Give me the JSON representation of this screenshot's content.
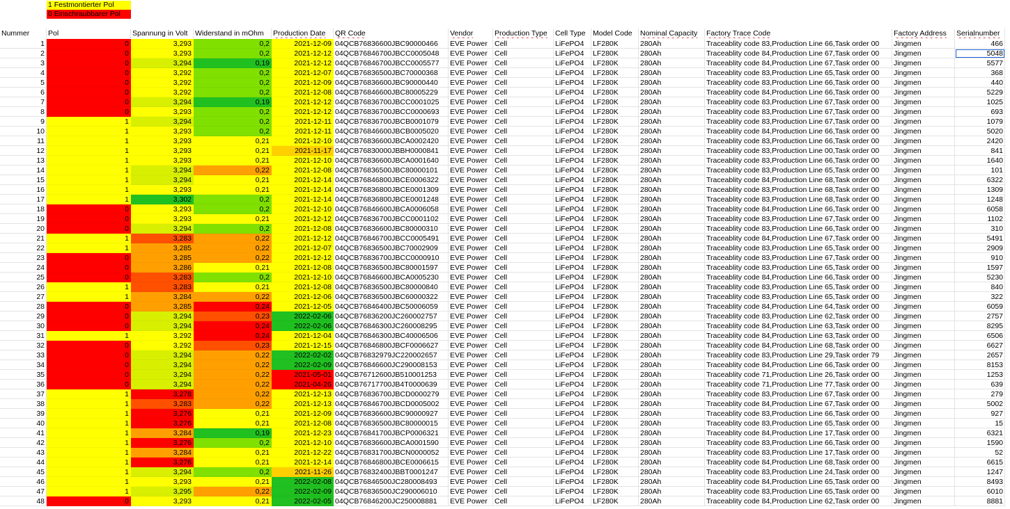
{
  "legend": [
    {
      "text": "1 Festmontierter Pol",
      "color": "#ffff00"
    },
    {
      "text": "0 Einschraubbarer Pol",
      "color": "#ff0000"
    }
  ],
  "headers": [
    "Nummer",
    "Pol",
    "Spannung in Volt",
    "Widerstand in mOhm",
    "Production Date",
    "QR Code",
    "Vendor",
    "Production Type",
    "Cell Type",
    "Model Code",
    "Nominal Capacity",
    "Factory Trace Code",
    "Factory Address",
    "Serialnumber"
  ],
  "constants": {
    "vendor": "EVE Power",
    "type": "Cell",
    "cell": "LiFePO4",
    "model": "LF280K",
    "capacity": "280Ah",
    "address": "Jingmen"
  },
  "colors": {
    "red": "#ff0000",
    "orange_red": "#ff5000",
    "orange": "#ffa000",
    "yellow_orange": "#ffd000",
    "yellow": "#ffff00",
    "yellow_green": "#d8f000",
    "light_green": "#80e000",
    "green": "#20c020",
    "selection": "#1f5fd6"
  },
  "rows": [
    [
      "1",
      "0",
      "3,293",
      "0,2",
      "2021-12-09",
      "04QCB76836600JBC90000466",
      "Traceablity code 83,Production Line 66,Task order 00",
      "466"
    ],
    [
      "2",
      "0",
      "3,293",
      "0,2",
      "2021-12-12",
      "04QCB76846700JBCC0005048",
      "Traceablity code 84,Production Line 67,Task order 00",
      "5048"
    ],
    [
      "3",
      "0",
      "3,294",
      "0,19",
      "2021-12-12",
      "04QCB76846700JBCC0005577",
      "Traceablity code 84,Production Line 67,Task order 00",
      "5577"
    ],
    [
      "4",
      "0",
      "3,292",
      "0,2",
      "2021-12-07",
      "04QCB76836500JBC70000368",
      "Traceablity code 83,Production Line 65,Task order 00",
      "368"
    ],
    [
      "5",
      "0",
      "3,292",
      "0,2",
      "2021-12-09",
      "04QCB76836600JBC90000440",
      "Traceablity code 83,Production Line 66,Task order 00",
      "440"
    ],
    [
      "6",
      "0",
      "3,292",
      "0,2",
      "2021-12-08",
      "04QCB76846600JBC80005229",
      "Traceablity code 84,Production Line 66,Task order 00",
      "5229"
    ],
    [
      "7",
      "0",
      "3,294",
      "0,19",
      "2021-12-12",
      "04QCB76836700JBCC0001025",
      "Traceablity code 83,Production Line 67,Task order 00",
      "1025"
    ],
    [
      "8",
      "0",
      "3,293",
      "0,2",
      "2021-12-12",
      "04QCB76836700JBCC0000693",
      "Traceablity code 83,Production Line 67,Task order 00",
      "693"
    ],
    [
      "9",
      "1",
      "3,294",
      "0,2",
      "2021-12-11",
      "04QCB76836700JBCB0001079",
      "Traceablity code 83,Production Line 67,Task order 00",
      "1079"
    ],
    [
      "10",
      "1",
      "3,293",
      "0,2",
      "2021-12-11",
      "04QCB76846600JBCB0005020",
      "Traceablity code 84,Production Line 66,Task order 00",
      "5020"
    ],
    [
      "11",
      "1",
      "3,293",
      "0,21",
      "2021-12-10",
      "04QCB76836600JBCA0002420",
      "Traceablity code 83,Production Line 66,Task order 00",
      "2420"
    ],
    [
      "12",
      "1",
      "3,293",
      "0,21",
      "2021-11-17",
      "04QCB76830000JBBH0000841",
      "Traceablity code 83,Production Line 00,Task order 00",
      "841"
    ],
    [
      "13",
      "1",
      "3,293",
      "0,21",
      "2021-12-10",
      "04QCB76836600JBCA0001640",
      "Traceablity code 83,Production Line 66,Task order 00",
      "1640"
    ],
    [
      "14",
      "1",
      "3,294",
      "0,22",
      "2021-12-08",
      "04QCB76836500JBC80000101",
      "Traceablity code 83,Production Line 65,Task order 00",
      "101"
    ],
    [
      "15",
      "1",
      "3,294",
      "0,21",
      "2021-12-14",
      "04QCB76846800JBCE0006322",
      "Traceablity code 84,Production Line 68,Task order 00",
      "6322"
    ],
    [
      "16",
      "1",
      "3,293",
      "0,21",
      "2021-12-14",
      "04QCB76836800JBCE0001309",
      "Traceablity code 83,Production Line 68,Task order 00",
      "1309"
    ],
    [
      "17",
      "1",
      "3,302",
      "0,2",
      "2021-12-14",
      "04QCB76836800JBCE0001248",
      "Traceablity code 83,Production Line 68,Task order 00",
      "1248"
    ],
    [
      "18",
      "0",
      "3,293",
      "0,2",
      "2021-12-10",
      "04QCB76846600JBCA0006058",
      "Traceablity code 84,Production Line 66,Task order 00",
      "6058"
    ],
    [
      "19",
      "0",
      "3,293",
      "0,21",
      "2021-12-12",
      "04QCB76836700JBCC0001102",
      "Traceablity code 83,Production Line 67,Task order 00",
      "1102"
    ],
    [
      "20",
      "0",
      "3,294",
      "0,2",
      "2021-12-08",
      "04QCB76836600JBC80000310",
      "Traceablity code 83,Production Line 66,Task order 00",
      "310"
    ],
    [
      "21",
      "1",
      "3,283",
      "0,22",
      "2021-12-12",
      "04QCB76846700JBCC0005491",
      "Traceablity code 84,Production Line 67,Task order 00",
      "5491"
    ],
    [
      "22",
      "1",
      "3,285",
      "0,22",
      "2021-12-07",
      "04QCB76836500JBC70002909",
      "Traceablity code 83,Production Line 65,Task order 00",
      "2909"
    ],
    [
      "23",
      "0",
      "3,285",
      "0,22",
      "2021-12-12",
      "04QCB76836700JBCC0000910",
      "Traceablity code 83,Production Line 67,Task order 00",
      "910"
    ],
    [
      "24",
      "0",
      "3,286",
      "0,21",
      "2021-12-08",
      "04QCB76836500JBC80001597",
      "Traceablity code 83,Production Line 65,Task order 00",
      "1597"
    ],
    [
      "25",
      "0",
      "3,283",
      "0,2",
      "2021-12-10",
      "04QCB76846600JBCA0005230",
      "Traceablity code 84,Production Line 66,Task order 00",
      "5230"
    ],
    [
      "26",
      "1",
      "3,283",
      "0,21",
      "2021-12-08",
      "04QCB76836500JBC80000840",
      "Traceablity code 83,Production Line 65,Task order 00",
      "840"
    ],
    [
      "27",
      "1",
      "3,284",
      "0,22",
      "2021-12-06",
      "04QCB76836500JBC60000322",
      "Traceablity code 83,Production Line 65,Task order 00",
      "322"
    ],
    [
      "28",
      "0",
      "3,285",
      "0,24",
      "2021-12-05",
      "04QCB76846400JBC50006059",
      "Traceablity code 84,Production Line 64,Task order 00",
      "6059"
    ],
    [
      "29",
      "0",
      "3,294",
      "0,23",
      "2022-02-06",
      "04QCB76836200JC260002757",
      "Traceablity code 83,Production Line 62,Task order 00",
      "2757"
    ],
    [
      "30",
      "0",
      "3,294",
      "0,24",
      "2022-02-06",
      "04QCB76846300JC260008295",
      "Traceablity code 84,Production Line 63,Task order 00",
      "8295"
    ],
    [
      "31",
      "1",
      "3,292",
      "0,24",
      "2021-12-04",
      "04QCB76846300JBC40006506",
      "Traceablity code 84,Production Line 63,Task order 00",
      "6506"
    ],
    [
      "32",
      "0",
      "3,292",
      "0,23",
      "2021-12-15",
      "04QCB76846800JBCF0006627",
      "Traceablity code 84,Production Line 68,Task order 00",
      "6627"
    ],
    [
      "33",
      "0",
      "3,294",
      "0,22",
      "2022-02-02",
      "04QCB76832979JC220002657",
      "Traceablity code 83,Production Line 29,Task order 79",
      "2657"
    ],
    [
      "34",
      "0",
      "3,294",
      "0,22",
      "2022-02-09",
      "04QCB76846600JC290008153",
      "Traceablity code 84,Production Line 66,Task order 00",
      "8153"
    ],
    [
      "35",
      "0",
      "3,294",
      "0,22",
      "2021-05-01",
      "04QCB76712600JB510001253",
      "Traceablity code 71,Production Line 26,Task order 00",
      "1253"
    ],
    [
      "36",
      "0",
      "3,294",
      "0,22",
      "2021-04-26",
      "04QCB76717700JB4T0000639",
      "Traceablity code 71,Production Line 77,Task order 00",
      "639"
    ],
    [
      "37",
      "1",
      "3,278",
      "0,22",
      "2021-12-13",
      "04QCB76836700JBCD0000279",
      "Traceablity code 83,Production Line 67,Task order 00",
      "279"
    ],
    [
      "38",
      "1",
      "3,283",
      "0,22",
      "2021-12-13",
      "04QCB76846700JBCD0005002",
      "Traceablity code 84,Production Line 67,Task order 00",
      "5002"
    ],
    [
      "39",
      "1",
      "3,276",
      "0,21",
      "2021-12-09",
      "04QCB76836600JBC90000927",
      "Traceablity code 83,Production Line 66,Task order 00",
      "927"
    ],
    [
      "40",
      "1",
      "3,276",
      "0,21",
      "2021-12-08",
      "04QCB76836500JBC80000015",
      "Traceablity code 83,Production Line 65,Task order 00",
      "15"
    ],
    [
      "41",
      "1",
      "3,284",
      "0,19",
      "2021-12-23",
      "04QCB76841700JBCP0006321",
      "Traceablity code 84,Production Line 17,Task order 00",
      "6321"
    ],
    [
      "42",
      "1",
      "3,276",
      "0,2",
      "2021-12-10",
      "04QCB76836600JBCA0001590",
      "Traceablity code 83,Production Line 66,Task order 00",
      "1590"
    ],
    [
      "43",
      "1",
      "3,284",
      "0,21",
      "2021-12-22",
      "04QCB76831700JBCN0000052",
      "Traceablity code 83,Production Line 17,Task order 00",
      "52"
    ],
    [
      "44",
      "1",
      "3,276",
      "0,21",
      "2021-12-14",
      "04QCB76846800JBCE0006615",
      "Traceablity code 84,Production Line 68,Task order 00",
      "6615"
    ],
    [
      "45",
      "1",
      "3,294",
      "0,2",
      "2021-11-26",
      "04QCB76832400JBBT0001247",
      "Traceablity code 83,Production Line 24,Task order 00",
      "1247"
    ],
    [
      "46",
      "1",
      "3,293",
      "0,21",
      "2022-02-08",
      "04QCB76846500JC280008493",
      "Traceablity code 84,Production Line 65,Task order 00",
      "8493"
    ],
    [
      "47",
      "1",
      "3,295",
      "0,22",
      "2022-02-09",
      "04QCB76836500JC290006010",
      "Traceablity code 83,Production Line 65,Task order 00",
      "6010"
    ],
    [
      "48",
      "0",
      "3,293",
      "0,21",
      "2022-02-05",
      "04QCB76846200JC250008881",
      "Traceablity code 84,Production Line 62,Task order 00",
      "8881"
    ]
  ]
}
